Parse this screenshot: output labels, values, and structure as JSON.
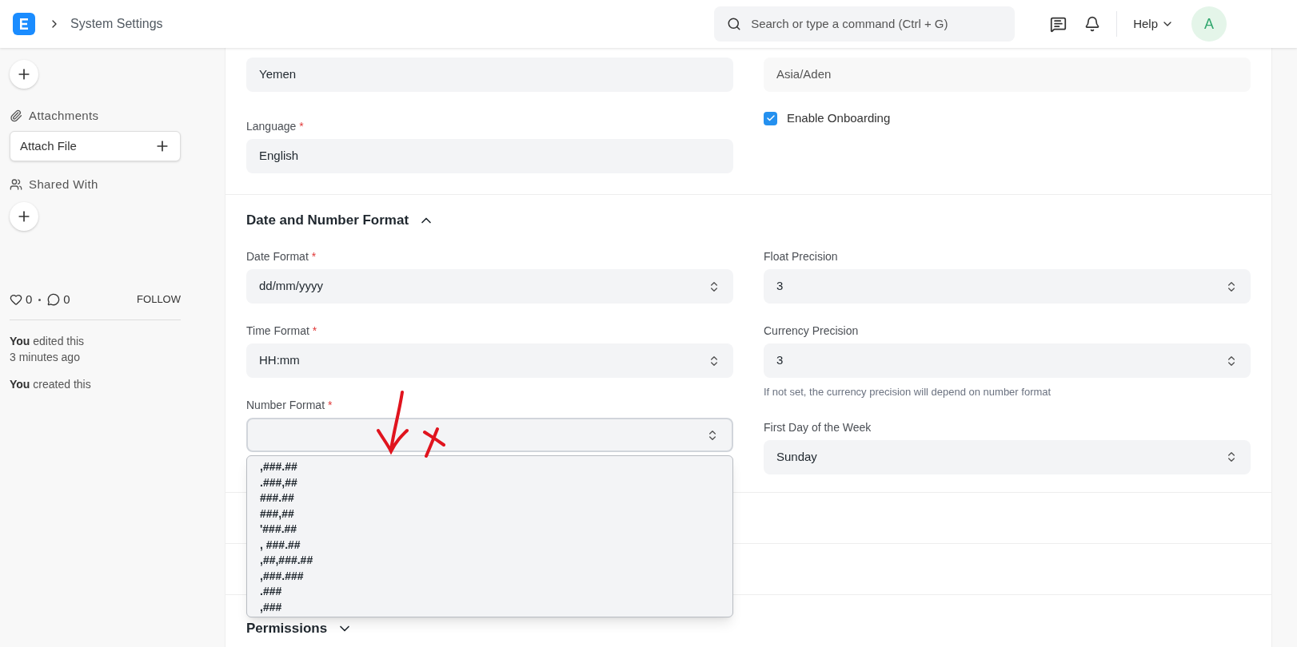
{
  "header": {
    "breadcrumb": "System Settings",
    "search": {
      "placeholder": "Search or type a command (Ctrl + G)"
    },
    "help": "Help",
    "avatar": "A"
  },
  "sidebar": {
    "attachments_label": "Attachments",
    "attach_button": "Attach File",
    "shared_label": "Shared With",
    "likes": "0",
    "comments": "0",
    "follow": "FOLLOW",
    "activity": [
      {
        "text": "**You** edited this",
        "time": "3 minutes ago"
      },
      {
        "text": "**You** created this"
      }
    ]
  },
  "top": {
    "left": [
      {
        "value": "Yemen"
      },
      {
        "label": "Language",
        "required_mark": "*",
        "value": "English"
      }
    ],
    "right_field": {
      "value": "Asia/Aden"
    },
    "checkbox": {
      "label": "Enable Onboarding",
      "checked": true
    }
  },
  "section": {
    "title": "Date and Number Format",
    "expanded": true,
    "left": [
      {
        "label": "Date Format",
        "required_mark": "*",
        "value": "dd/mm/yyyy"
      },
      {
        "label": "Time Format",
        "required_mark": "*",
        "value": "HH:mm"
      },
      {
        "label": "Number Format",
        "required_mark": "*",
        "open": true,
        "options": [
          ",###.##",
          ".###,##",
          "###.##",
          "###,##",
          "'###.##",
          ", ###.##",
          ",##,###.##",
          ",###.###",
          ".###",
          ",###"
        ]
      }
    ],
    "right": [
      {
        "label": "Float Precision",
        "value": "3"
      },
      {
        "label": "Currency Precision",
        "value": "3",
        "help": "If not set, the currency precision will depend on number format"
      },
      {
        "label": "First Day of the Week",
        "value": "Sunday"
      }
    ]
  },
  "permissions": {
    "title": "Permissions",
    "expanded": false
  }
}
